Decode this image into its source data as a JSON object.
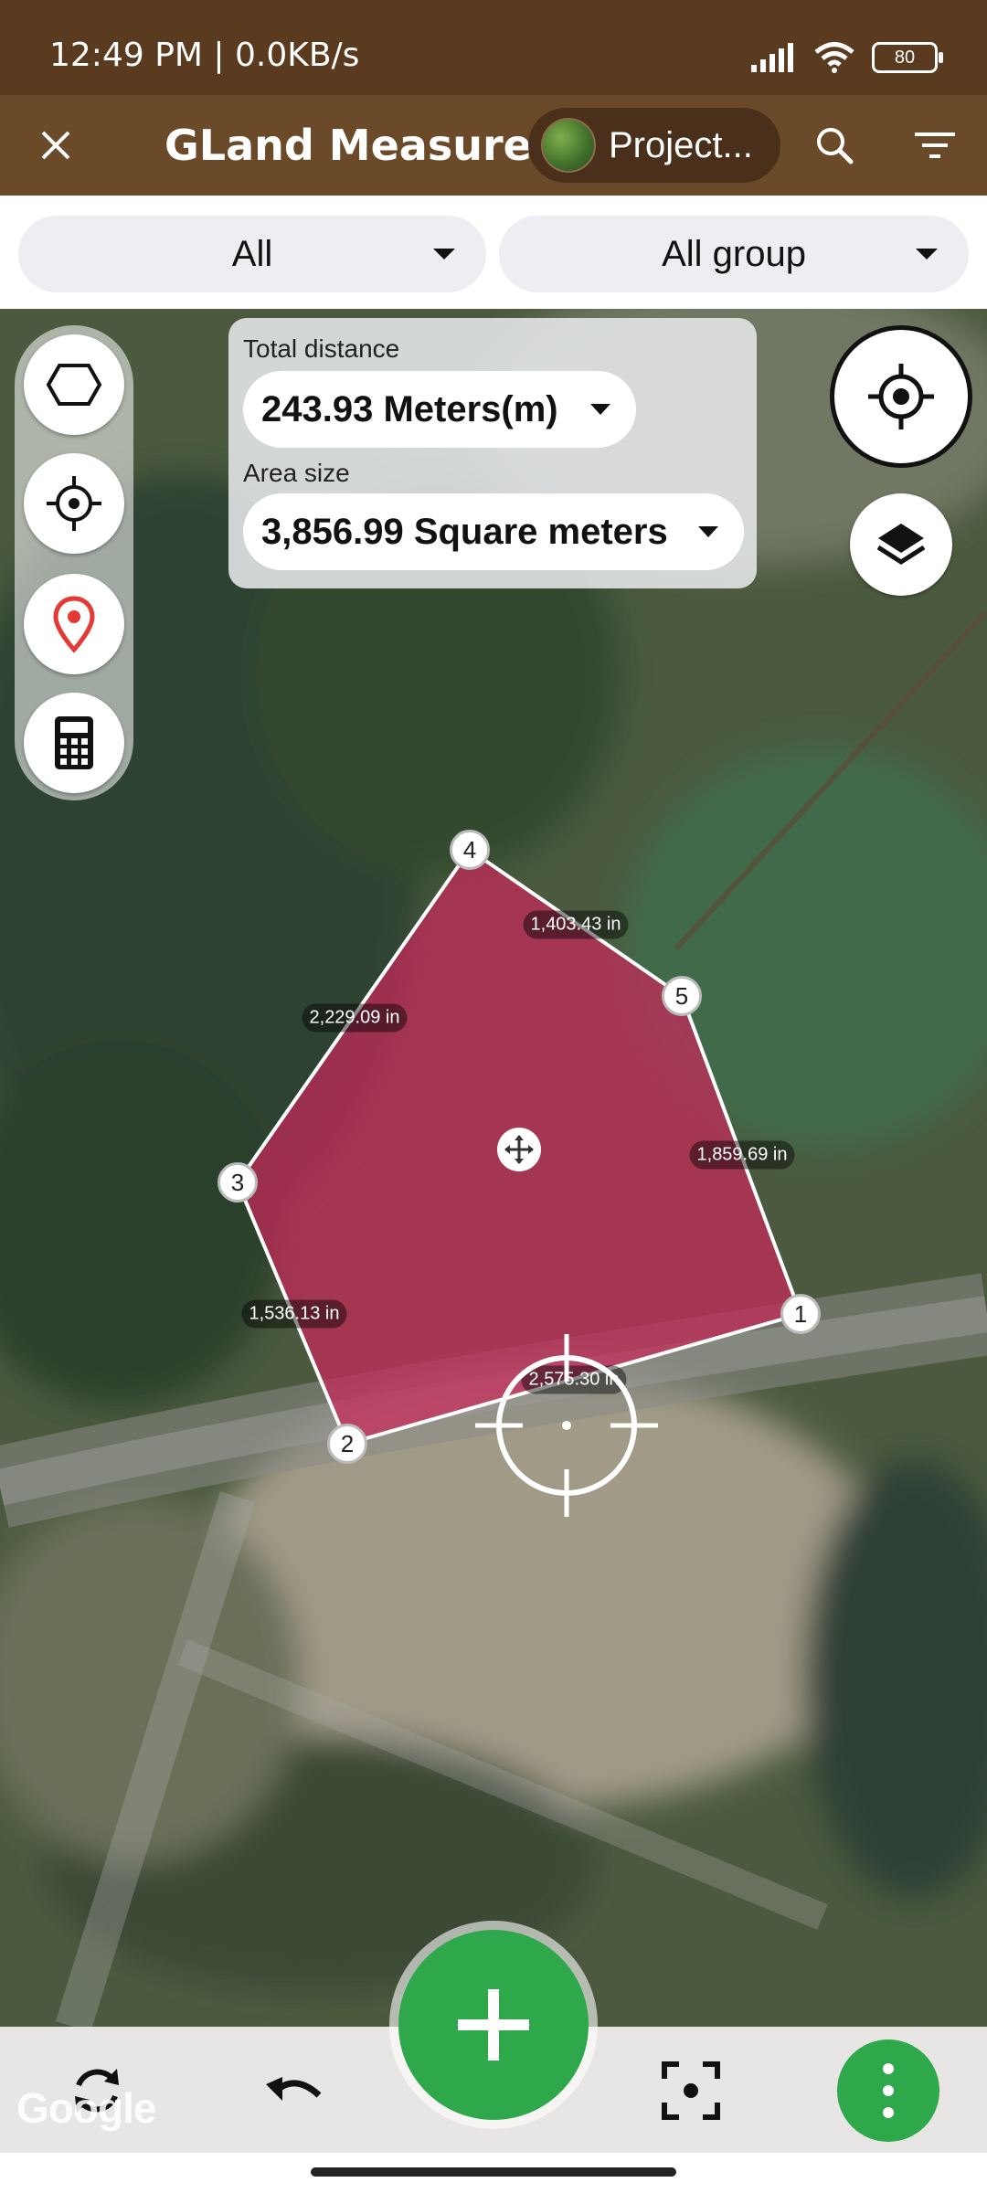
{
  "status_bar": {
    "time": "12:49 PM | 0.0KB/s",
    "battery": "80",
    "icons": [
      "signal-icon",
      "wifi-icon",
      "battery-icon"
    ]
  },
  "app_bar": {
    "title": "GLand Measure",
    "project_label": "Project...",
    "icons": [
      "close-icon",
      "search-icon",
      "filter-icon"
    ]
  },
  "filters": {
    "type": "All",
    "group": "All group"
  },
  "measure": {
    "distance_label": "Total distance",
    "distance_value": "243.93 Meters(m)",
    "area_label": "Area size",
    "area_value": "3,856.99 Square meters"
  },
  "vertices": [
    "1",
    "2",
    "3",
    "4",
    "5"
  ],
  "edges": [
    "2,575.30 in",
    "1,536.13 in",
    "2,229.09 in",
    "1,403.43 in",
    "1,859.69 in"
  ],
  "map_attribution": "Google",
  "colors": {
    "app_bar": "#6b4a2a",
    "status_bar": "#5a3b20",
    "polygon_fill": "#c8285a",
    "accent_green": "#2ea84a"
  },
  "tools": [
    "polygon-tool-icon",
    "locate-icon",
    "pin-icon",
    "calculator-icon"
  ],
  "bottom_actions": [
    "refresh-icon",
    "undo-icon",
    "add-icon",
    "focus-icon",
    "more-icon"
  ]
}
